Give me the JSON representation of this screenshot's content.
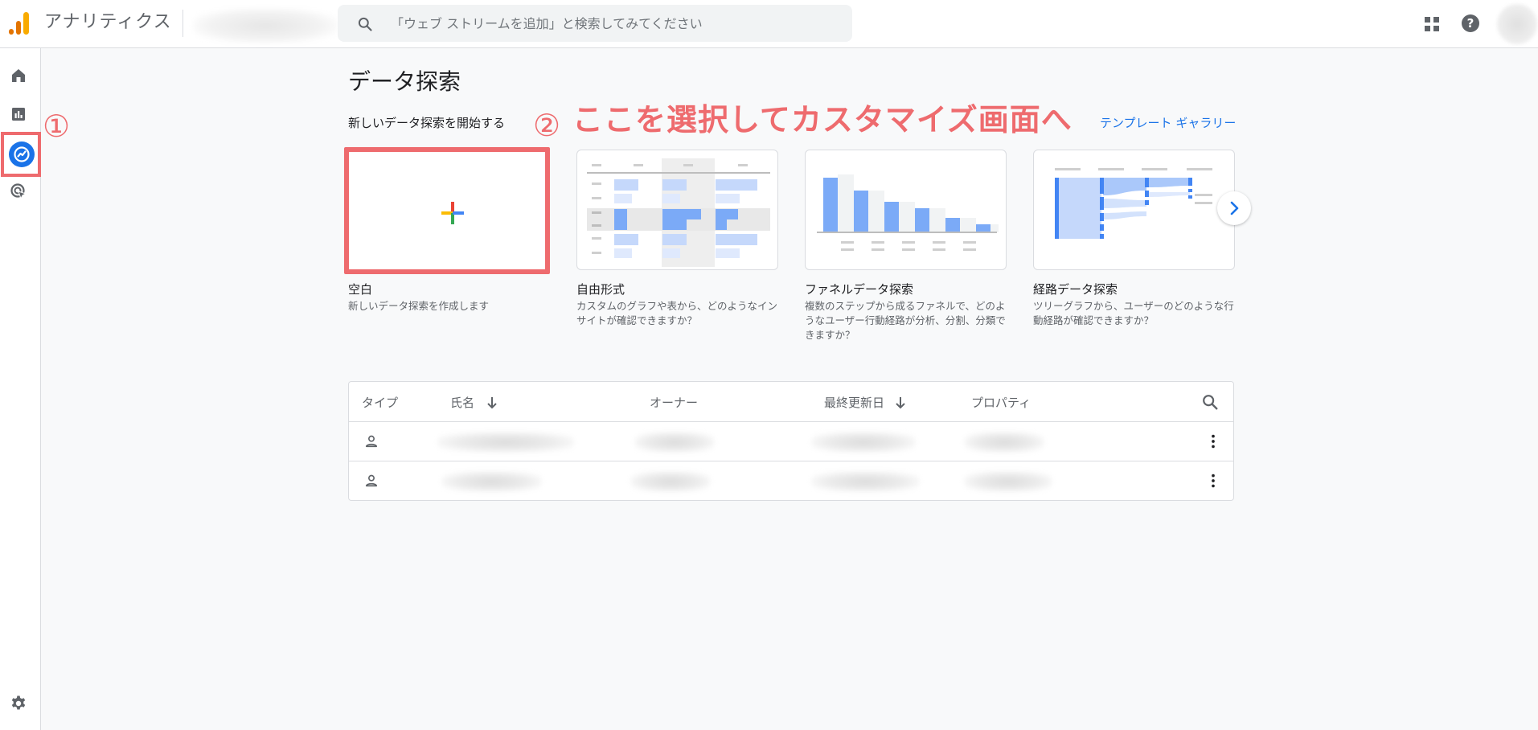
{
  "header": {
    "app_title": "アナリティクス",
    "search": {
      "placeholder": "「ウェブ ストリームを追加」と検索してみてください"
    },
    "icons": [
      "analytics-logo-icon",
      "search-icon",
      "apps-grid-icon",
      "help-icon"
    ]
  },
  "sidebar": {
    "items": [
      {
        "name": "home",
        "icon": "home-icon"
      },
      {
        "name": "reports",
        "icon": "bar-chart-icon"
      },
      {
        "name": "explore",
        "icon": "explore-icon",
        "active": true
      },
      {
        "name": "advertising",
        "icon": "advertising-icon"
      }
    ],
    "settings_icon": "gear-icon"
  },
  "annotations": {
    "step1": "①",
    "step2": "②",
    "text": "ここを選択してカスタマイズ画面へ",
    "color": "#ee6b6e"
  },
  "main": {
    "title": "データ探索",
    "section_label": "新しいデータ探索を開始する",
    "gallery_link": "テンプレート ギャラリー",
    "cards": [
      {
        "title": "空白",
        "desc": "新しいデータ探索を作成します",
        "selected": true
      },
      {
        "title": "自由形式",
        "desc_lines": [
          "カスタムのグラフや表から、どのようなイン",
          "サイトが確認できますか？"
        ]
      },
      {
        "title": "ファネルデータ探索",
        "desc_lines": [
          "複数のステップから成るファネルで、どのよ",
          "うなユーザー行動経路が分析、分割、分類で",
          "きますか？"
        ]
      },
      {
        "title": "経路データ探索",
        "desc_lines": [
          "ツリーグラフから、ユーザーのどのような行",
          "動経路が確認できますか？"
        ]
      }
    ]
  },
  "table": {
    "headers": {
      "type": "タイプ",
      "name": "氏名",
      "owner": "オーナー",
      "updated": "最終更新日",
      "property": "プロパティ"
    },
    "rows": [
      {
        "type_icon": "person-icon"
      },
      {
        "type_icon": "person-icon"
      }
    ]
  },
  "colors": {
    "accent": "#1a73e8",
    "annotation": "#ee6b6e",
    "background": "#f8f9fa"
  }
}
